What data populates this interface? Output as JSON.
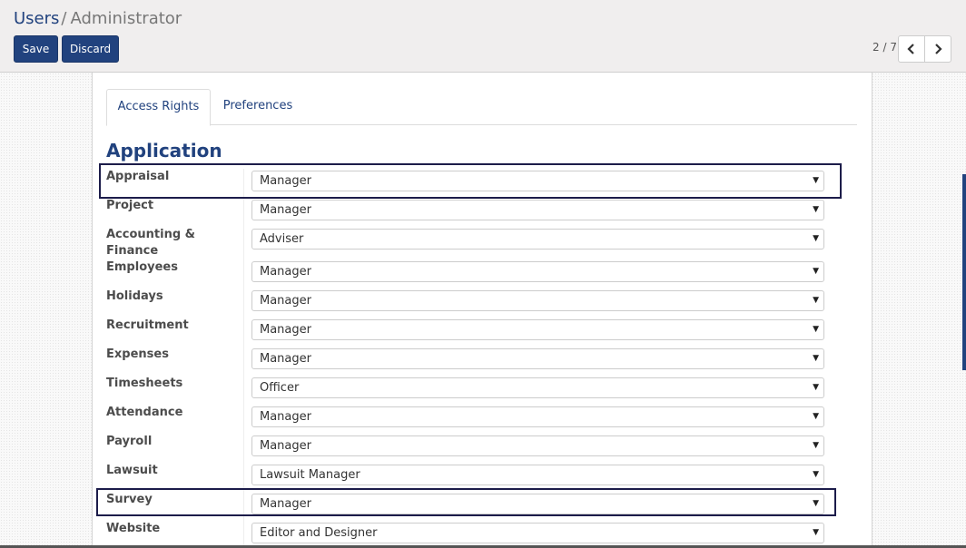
{
  "breadcrumb": {
    "parent": "Users",
    "separator": "/",
    "current": "Administrator"
  },
  "toolbar": {
    "save_label": "Save",
    "discard_label": "Discard"
  },
  "pager": {
    "value": "2 / 7",
    "prev_icon": "chevron-left-icon",
    "next_icon": "chevron-right-icon"
  },
  "tabs": [
    {
      "label": "Access Rights",
      "active": true
    },
    {
      "label": "Preferences",
      "active": false
    }
  ],
  "section": {
    "title": "Application"
  },
  "rows": [
    {
      "label": "Appraisal",
      "value": "Manager",
      "highlighted": true
    },
    {
      "label": "Project",
      "value": "Manager"
    },
    {
      "label": "Accounting & Finance",
      "value": "Adviser"
    },
    {
      "label": "Employees",
      "value": "Manager"
    },
    {
      "label": "Holidays",
      "value": "Manager"
    },
    {
      "label": "Recruitment",
      "value": "Manager"
    },
    {
      "label": "Expenses",
      "value": "Manager"
    },
    {
      "label": "Timesheets",
      "value": "Officer"
    },
    {
      "label": "Attendance",
      "value": "Manager"
    },
    {
      "label": "Payroll",
      "value": "Manager"
    },
    {
      "label": "Lawsuit",
      "value": "Lawsuit Manager"
    },
    {
      "label": "Survey",
      "value": "Manager",
      "highlighted": true
    },
    {
      "label": "Website",
      "value": "Editor and Designer"
    }
  ],
  "colors": {
    "brand": "#21427e",
    "highlight_border": "#1c1c4a"
  }
}
